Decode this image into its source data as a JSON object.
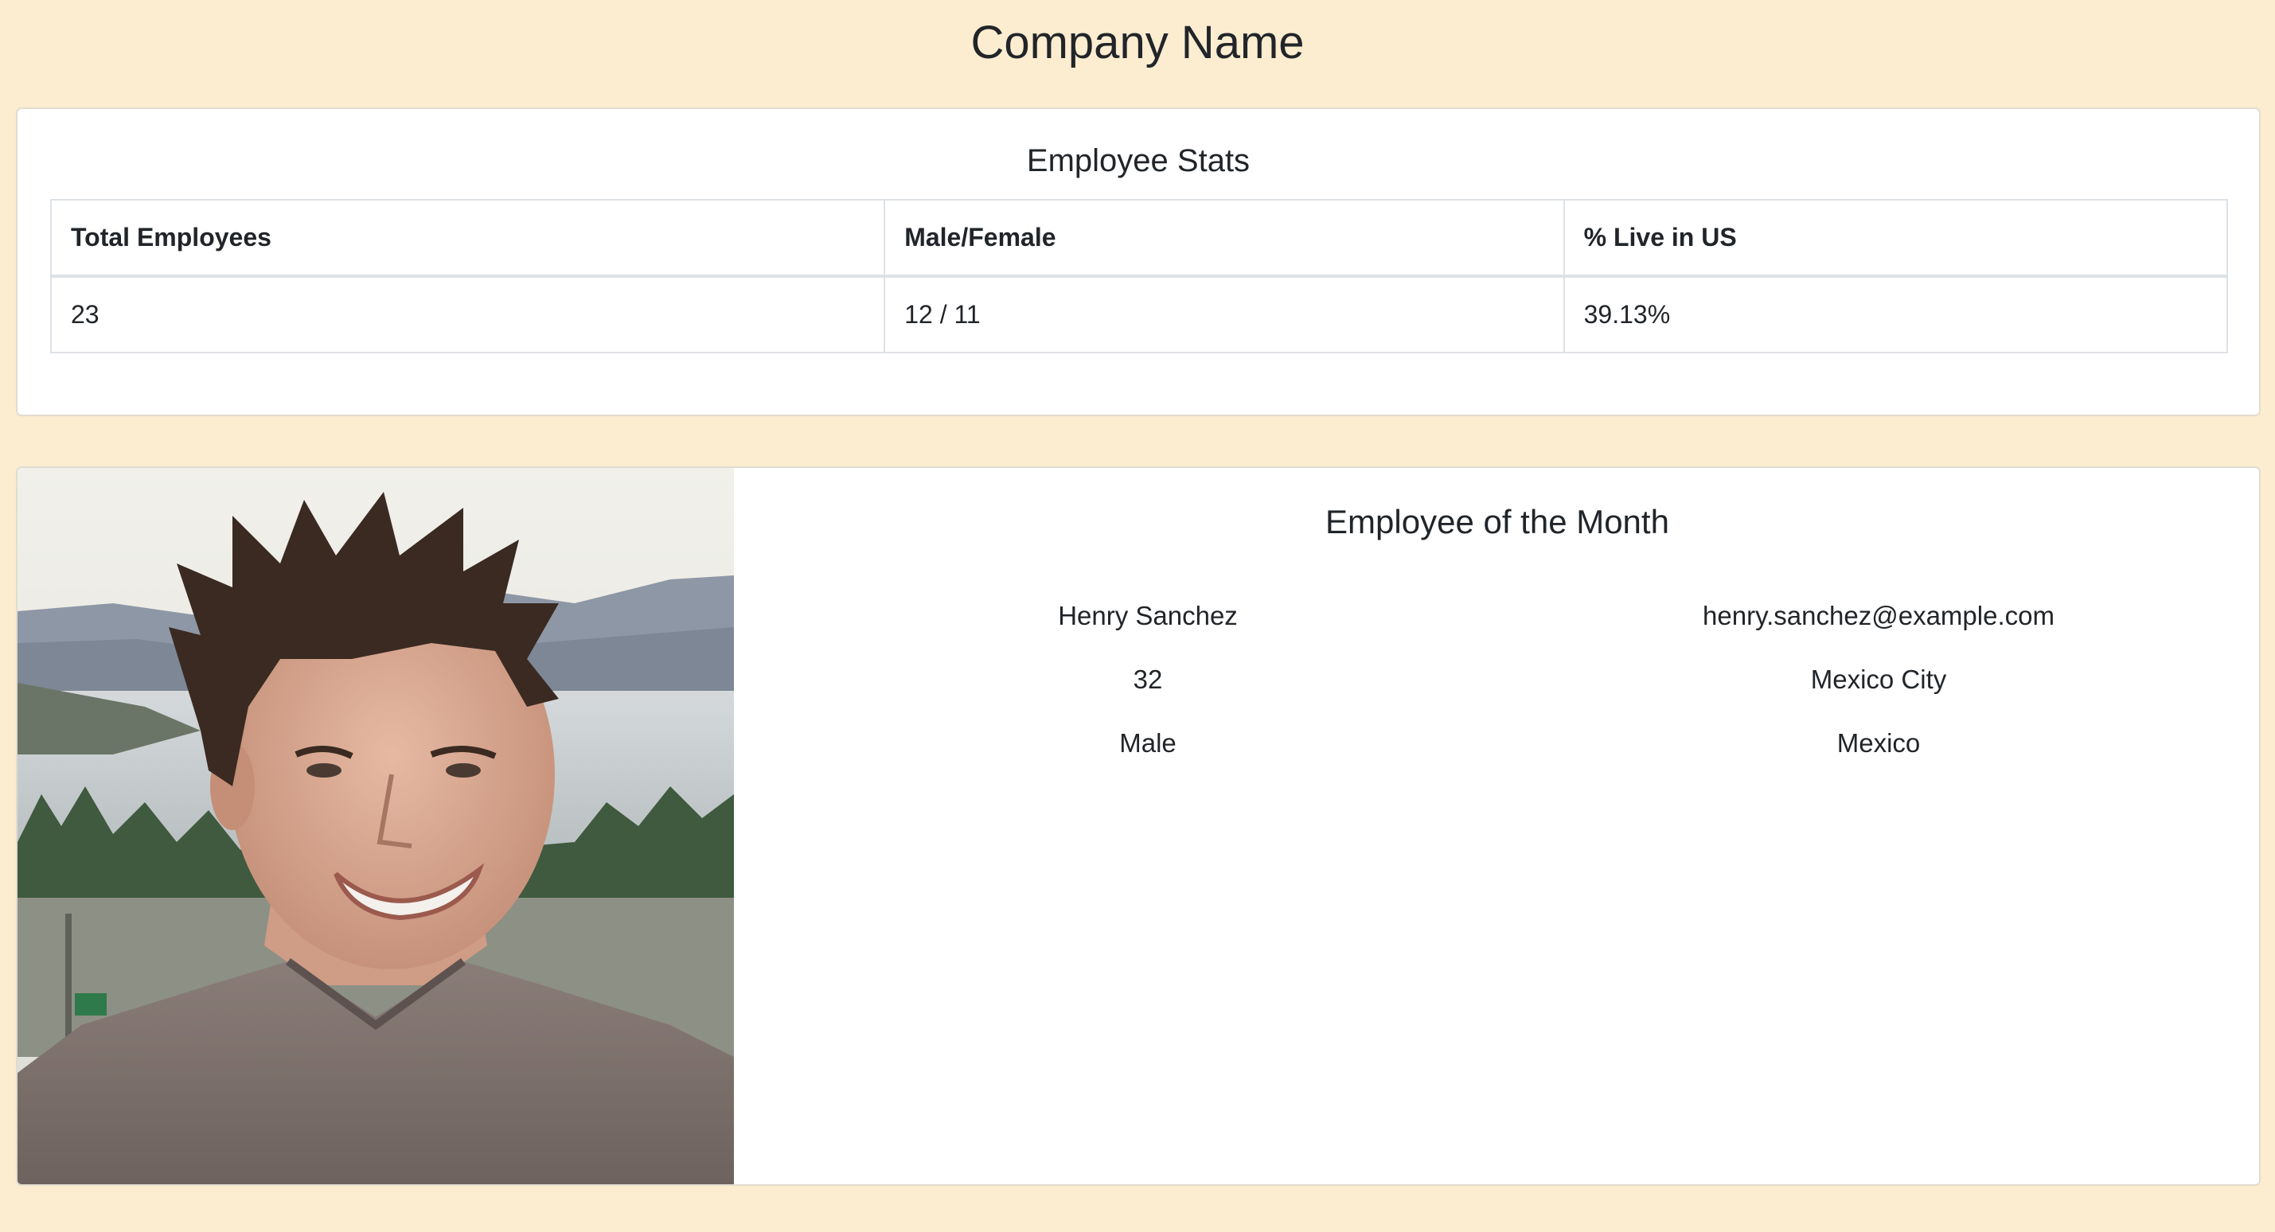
{
  "header": {
    "title": "Company Name"
  },
  "stats": {
    "title": "Employee Stats",
    "columns": [
      "Total Employees",
      "Male/Female",
      "% Live in US"
    ],
    "row": {
      "total_employees": "23",
      "male_female": "12 / 11",
      "pct_live_in_us": "39.13%"
    }
  },
  "employee_of_month": {
    "title": "Employee of the Month",
    "photo_icon": "employee-photo",
    "name": "Henry Sanchez",
    "email": "henry.sanchez@example.com",
    "age": "32",
    "city": "Mexico City",
    "gender": "Male",
    "country": "Mexico"
  },
  "colors": {
    "page_background": "#fcecd0",
    "card_background": "#ffffff",
    "text": "#212529",
    "table_border": "#dee2e6"
  }
}
